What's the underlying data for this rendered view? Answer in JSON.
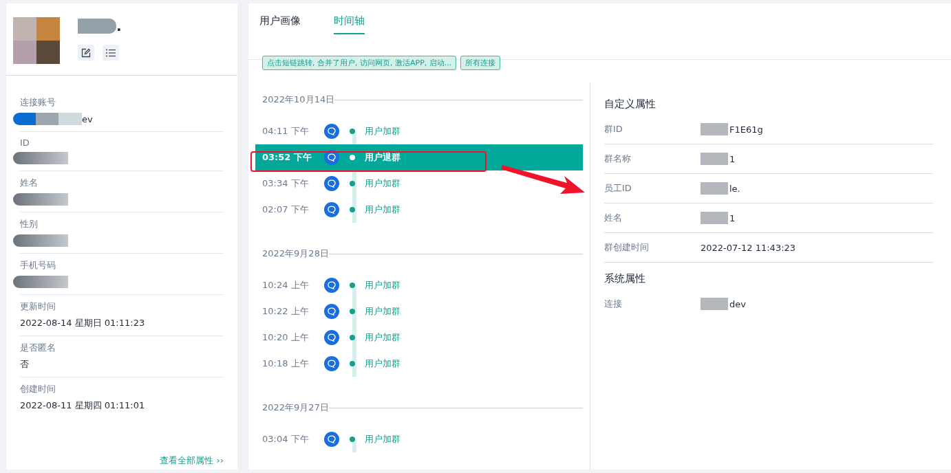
{
  "profile": {
    "name_suffix": "."
  },
  "attributes": [
    {
      "label": "连接账号",
      "value": "ev",
      "redacted": true
    },
    {
      "label": "ID",
      "redacted": true
    },
    {
      "label": "姓名",
      "redacted": true
    },
    {
      "label": "性别",
      "redacted": true
    },
    {
      "label": "手机号码",
      "redacted": true
    },
    {
      "label": "更新时间",
      "value": "2022-08-14 星期日 01:11:23",
      "redacted": false
    },
    {
      "label": "是否匿名",
      "value": "否",
      "redacted": false
    },
    {
      "label": "创建时间",
      "value": "2022-08-11 星期四 01:11:01",
      "redacted": false
    }
  ],
  "view_all_link": "查看全部属性 ››",
  "tabs": [
    {
      "label": "用户画像",
      "selected": false
    },
    {
      "label": "时间轴",
      "selected": true
    }
  ],
  "filter_tags": [
    "点击短链跳转, 合并了用户, 访问网页, 激活APP, 启动...",
    "所有连接"
  ],
  "timeline": [
    {
      "date": "2022年10月14日",
      "events": [
        {
          "time": "04:11 下午",
          "event": "用户加群",
          "selected": false
        },
        {
          "time": "03:52 下午",
          "event": "用户退群",
          "selected": true
        },
        {
          "time": "03:34 下午",
          "event": "用户加群",
          "selected": false
        },
        {
          "time": "02:07 下午",
          "event": "用户加群",
          "selected": false
        }
      ]
    },
    {
      "date": "2022年9月28日",
      "events": [
        {
          "time": "10:24 上午",
          "event": "用户加群",
          "selected": false
        },
        {
          "time": "10:22 上午",
          "event": "用户加群",
          "selected": false
        },
        {
          "time": "10:20 上午",
          "event": "用户加群",
          "selected": false
        },
        {
          "time": "10:18 上午",
          "event": "用户加群",
          "selected": false
        }
      ]
    },
    {
      "date": "2022年9月27日",
      "events": [
        {
          "time": "03:04 下午",
          "event": "用户加群",
          "selected": false
        }
      ]
    }
  ],
  "details": [
    {
      "title": "自定义属性",
      "rows": [
        {
          "label": "群ID",
          "value": "F1E61g",
          "redacted": true
        },
        {
          "label": "群名称",
          "value": "1",
          "redacted": true
        },
        {
          "label": "员工ID",
          "value": "le.",
          "redacted": true
        },
        {
          "label": "姓名",
          "value": "1",
          "redacted": true
        },
        {
          "label": "群创建时间",
          "value": "2022-07-12 11:43:23",
          "redacted": false
        }
      ]
    },
    {
      "title": "系统属性",
      "rows": [
        {
          "label": "连接",
          "value": "dev",
          "redacted": true
        }
      ]
    }
  ]
}
